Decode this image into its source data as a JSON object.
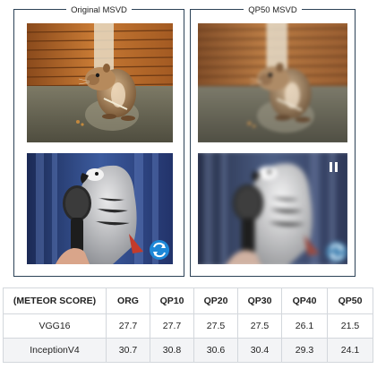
{
  "panels": {
    "left_title": "Original MSVD",
    "right_title": "QP50 MSVD"
  },
  "icons": {
    "replay": "replay-arrows-icon",
    "pause": "pause-icon"
  },
  "colors": {
    "panel_border": "#2c4257",
    "table_border": "#d3d7dc",
    "row_shade": "#f3f4f6",
    "replay_badge": "#1e88d8"
  },
  "table": {
    "headers": [
      "(METEOR SCORE)",
      "ORG",
      "QP10",
      "QP20",
      "QP30",
      "QP40",
      "QP50"
    ],
    "rows": [
      [
        "VGG16",
        "27.7",
        "27.7",
        "27.5",
        "27.5",
        "26.1",
        "21.5"
      ],
      [
        "InceptionV4",
        "30.7",
        "30.8",
        "30.6",
        "30.4",
        "29.3",
        "24.1"
      ]
    ]
  }
}
